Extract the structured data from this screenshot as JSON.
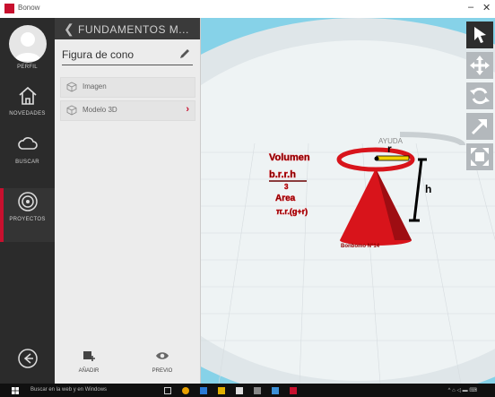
{
  "titlebar": {
    "app_name": "Bonow",
    "minimize_glyph": "–",
    "close_glyph": "✕"
  },
  "nav": {
    "profile": "PERFIL",
    "news": "NOVEDADES",
    "search": "BUSCAR",
    "projects": "PROYECTOS",
    "logout_icon": "logout-icon"
  },
  "panel": {
    "title": "FUNDAMENTOS M...",
    "design_name": "Figura de cono",
    "items": [
      {
        "label": "Imagen"
      },
      {
        "label": "Modelo 3D"
      }
    ],
    "add_label": "AÑADIR",
    "preview_label": "PREVIO"
  },
  "scene": {
    "line1": "Volumen",
    "line2": "b.r.r.h",
    "line3": "3",
    "line4": "Area",
    "line5": "π.r.(g+r)",
    "radius_label": "r",
    "height_label": "h",
    "base_label": "Bonbomo N°14",
    "ring_text": "AYUDA",
    "colors": {
      "model_red": "#d8141b",
      "floor": "#e8eef0",
      "sky": "#86d2e8"
    }
  },
  "toolbar": {
    "tools": [
      "select-tool",
      "move-tool",
      "rotate-tool",
      "scale-tool",
      "frame-tool"
    ]
  },
  "taskbar": {
    "search_text": "Buscar en la web y en Windows",
    "tray_text": "^ ⌂ ◁ ▬ ⌨"
  }
}
